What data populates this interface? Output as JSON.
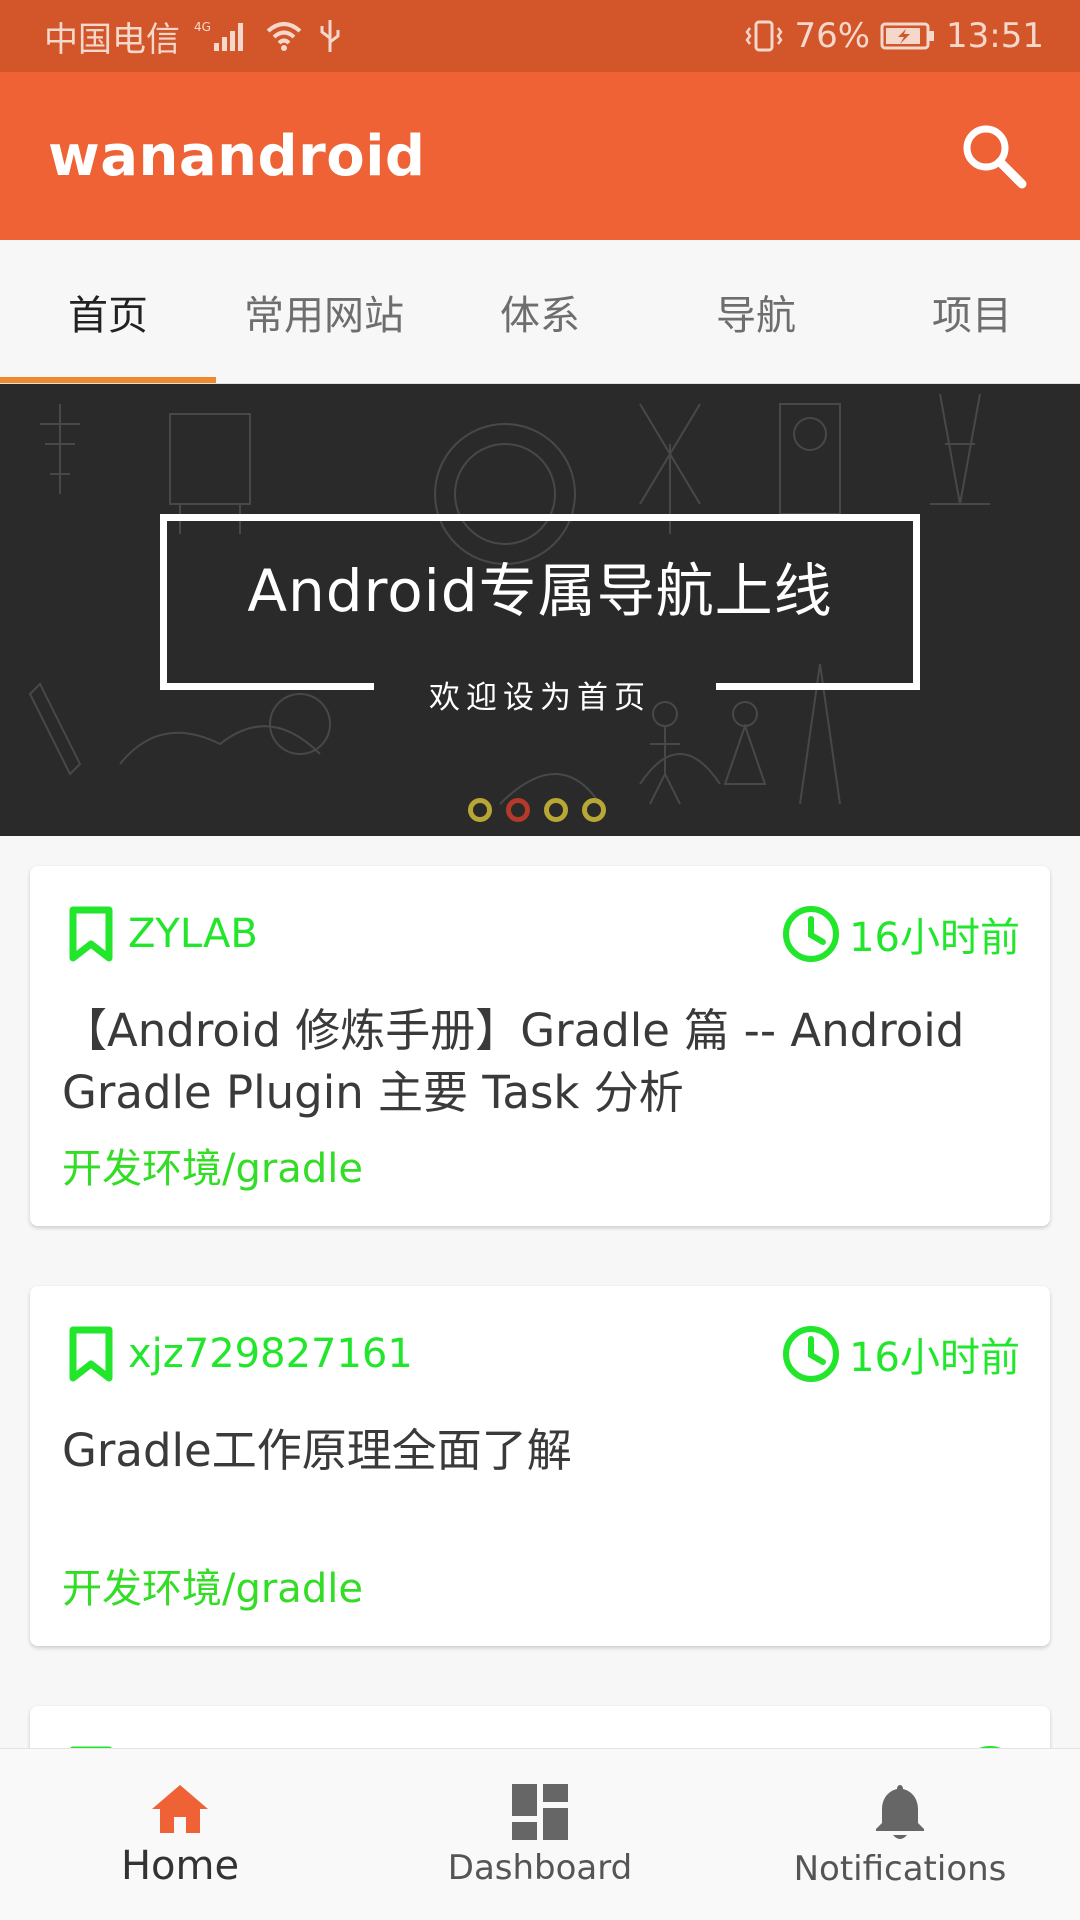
{
  "status_bar": {
    "carrier": "中国电信",
    "network": "4G",
    "battery": "76%",
    "time": "13:51",
    "icons": [
      "signal-icon",
      "wifi-icon",
      "usb-icon",
      "vibrate-icon",
      "battery-charging-icon"
    ]
  },
  "app_bar": {
    "title": "wanandroid",
    "search_icon": "search-icon"
  },
  "tabs": [
    {
      "label": "首页",
      "active": true
    },
    {
      "label": "常用网站",
      "active": false
    },
    {
      "label": "体系",
      "active": false
    },
    {
      "label": "导航",
      "active": false
    },
    {
      "label": "项目",
      "active": false
    }
  ],
  "banner": {
    "title": "Android专属导航上线",
    "subtitle": "欢迎设为首页",
    "page_count": 4,
    "active_index": 1
  },
  "articles": [
    {
      "author": "ZYLAB",
      "time": "16小时前",
      "title": "【Android 修炼手册】Gradle 篇 -- Android Gradle Plugin 主要 Task 分析",
      "category": "开发环境/gradle"
    },
    {
      "author": "xjz729827161",
      "time": "16小时前",
      "title": "Gradle工作原理全面了解",
      "category": "开发环境/gradle"
    }
  ],
  "bottom_nav": [
    {
      "label": "Home",
      "icon": "home-icon",
      "active": true
    },
    {
      "label": "Dashboard",
      "icon": "dashboard-icon",
      "active": false
    },
    {
      "label": "Notifications",
      "icon": "bell-icon",
      "active": false
    }
  ],
  "colors": {
    "status_bar": "#d3552a",
    "app_bar": "#ee6236",
    "tab_indicator": "#ef8a2c",
    "accent_green": "#22e62c",
    "nav_active": "#ee6236"
  }
}
